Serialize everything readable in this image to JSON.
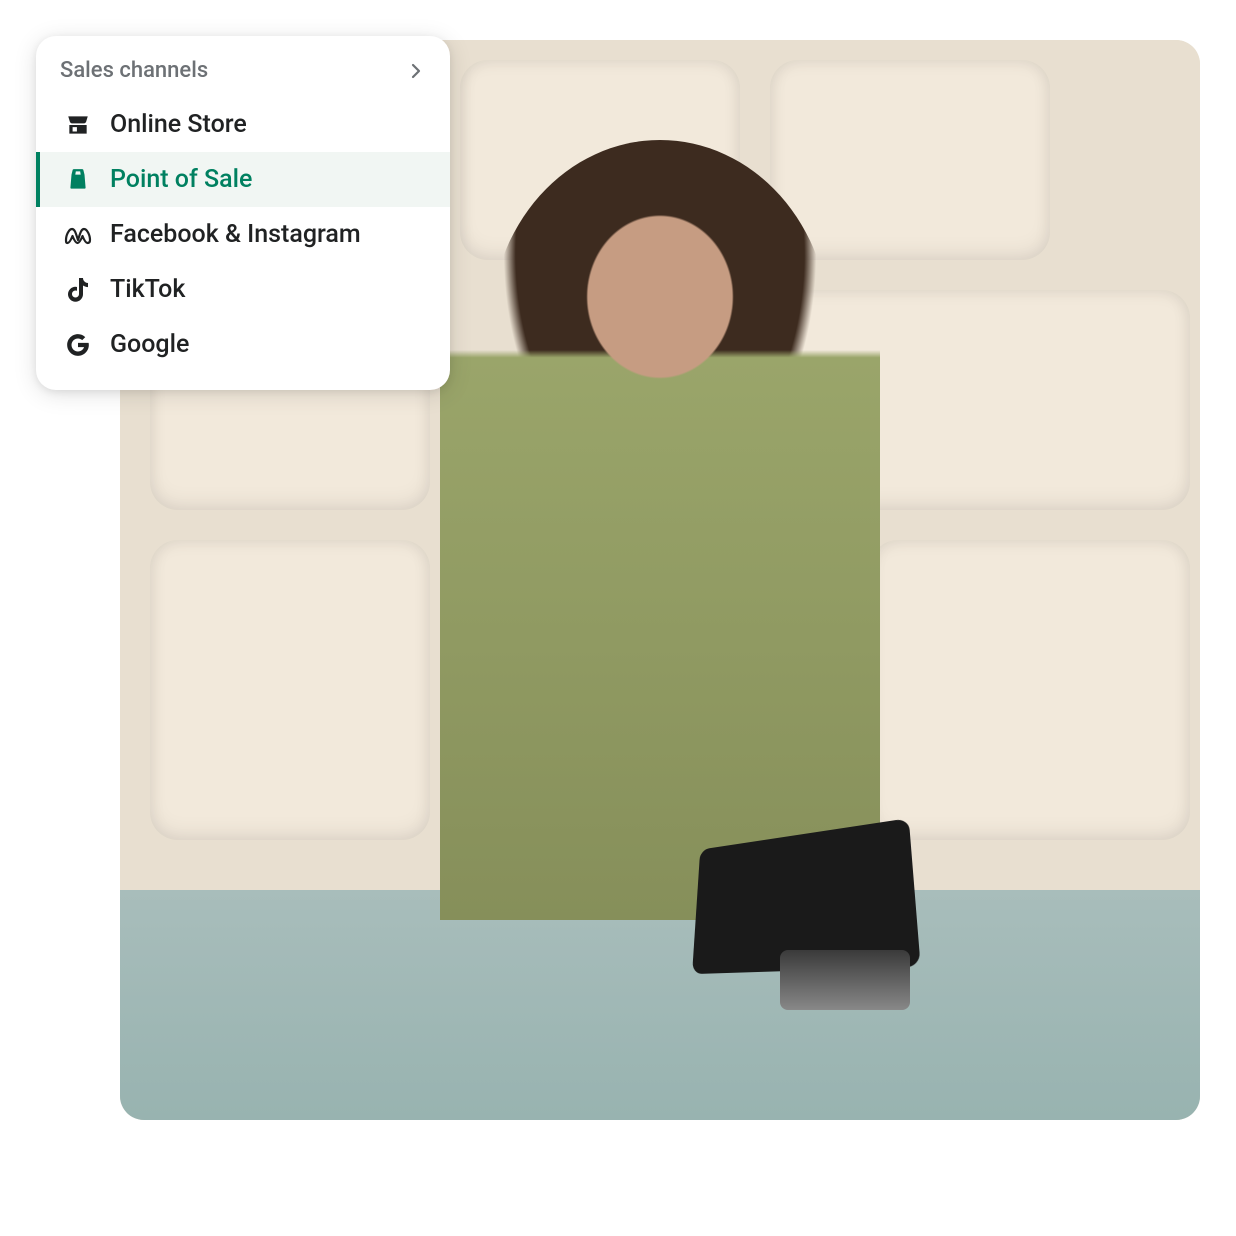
{
  "menu": {
    "title": "Sales channels",
    "items": [
      {
        "id": "online-store",
        "label": "Online Store",
        "icon": "storefront-icon",
        "active": false
      },
      {
        "id": "point-of-sale",
        "label": "Point of Sale",
        "icon": "shopify-bag-icon",
        "active": true
      },
      {
        "id": "facebook-instagram",
        "label": "Facebook & Instagram",
        "icon": "meta-icon",
        "active": false
      },
      {
        "id": "tiktok",
        "label": "TikTok",
        "icon": "tiktok-icon",
        "active": false
      },
      {
        "id": "google",
        "label": "Google",
        "icon": "google-icon",
        "active": false
      }
    ]
  },
  "colors": {
    "accent": "#008060",
    "textPrimary": "#202223",
    "textSecondary": "#6d7175",
    "activeBg": "#f1f6f3"
  },
  "background": {
    "description": "Photograph of a person in a green cardigan using a black Shopify POS tablet at a retail counter with cream shelving niches behind."
  }
}
